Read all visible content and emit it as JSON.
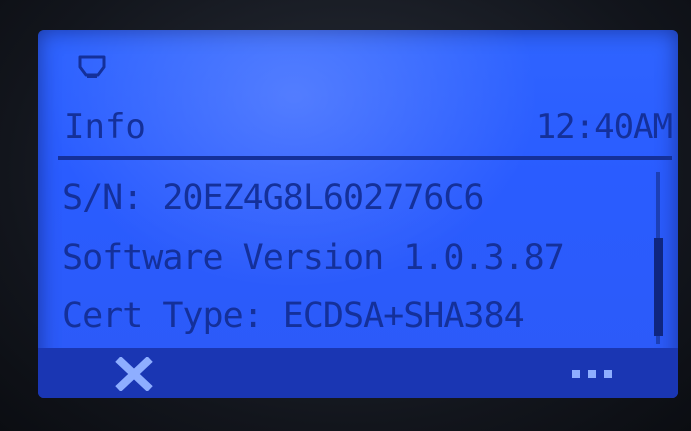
{
  "header": {
    "title": "Info",
    "time": "12:40AM",
    "status_icon": "network-icon"
  },
  "info": {
    "lines": [
      "S/N: 20EZ4G8L602776C6",
      "Software Version 1.0.3.87",
      "Cert Type: ECDSA+SHA384"
    ]
  },
  "softkeys": {
    "left_icon": "close-icon",
    "right_icon": "more-icon"
  },
  "colors": {
    "screen_background": "#2c5cff",
    "text": "#14309a",
    "softkey_bar": "#1a36b3",
    "softkey_glyph": "#7fa2ff"
  }
}
